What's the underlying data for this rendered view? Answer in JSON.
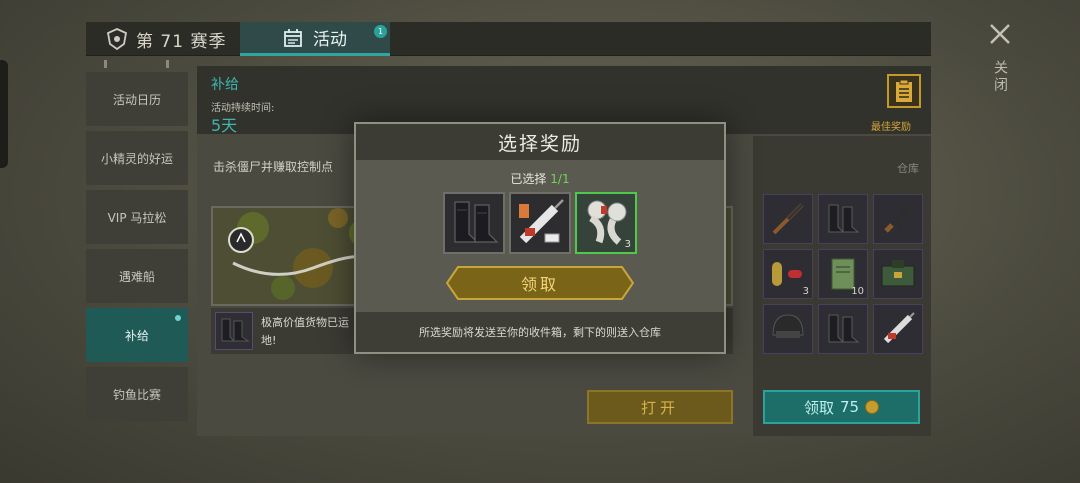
{
  "tabs": {
    "season_label": "第 71 赛季",
    "activity_label": "活动",
    "activity_badge": "1"
  },
  "close_label": "关闭",
  "sidebar": {
    "items": [
      {
        "label": "活动日历"
      },
      {
        "label": "小精灵的好运"
      },
      {
        "label": "VIP 马拉松"
      },
      {
        "label": "遇难船"
      },
      {
        "label": "补给"
      },
      {
        "label": "钓鱼比赛"
      }
    ]
  },
  "main": {
    "title": "补给",
    "duration_label": "活动持续时间:",
    "duration_value": "5天",
    "best_reward_label": "最佳奖励",
    "kill_text": "击杀僵尸并赚取控制点",
    "info_text_line1": "极高价值货物已运",
    "info_text_line2": "地!",
    "open_button": "打开"
  },
  "storage": {
    "label": "仓库",
    "items": [
      {
        "icon": "rifle-icon",
        "count": ""
      },
      {
        "icon": "boots-icon",
        "count": ""
      },
      {
        "icon": "assault-rifle-icon",
        "count": ""
      },
      {
        "icon": "pill-icon",
        "count": "3"
      },
      {
        "icon": "notebook-icon",
        "count": "10"
      },
      {
        "icon": "supply-crate-icon",
        "count": ""
      },
      {
        "icon": "helmet-icon",
        "count": ""
      },
      {
        "icon": "boots-icon",
        "count": ""
      },
      {
        "icon": "syringe-icon",
        "count": ""
      }
    ],
    "claim_label": "领取",
    "claim_cost": "75"
  },
  "modal": {
    "title": "选择奖励",
    "selected_prefix": "已选择",
    "selected_count": "1/1",
    "choices": [
      {
        "icon": "boots-icon",
        "count": ""
      },
      {
        "icon": "syringe-icon",
        "count": ""
      },
      {
        "icon": "bandage-icon",
        "count": "3"
      }
    ],
    "claim_label": "领取",
    "footer": "所选奖励将发送至你的收件箱，剩下的则送入仓库"
  }
}
